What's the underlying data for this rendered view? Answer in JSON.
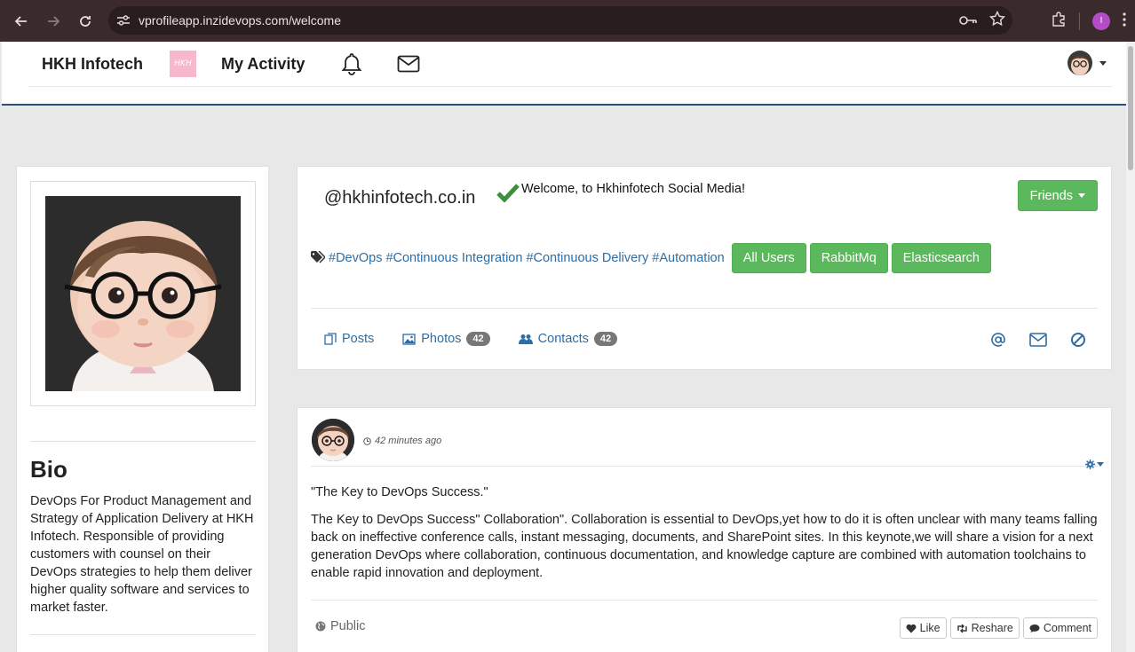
{
  "browser": {
    "url": "vprofileapp.inzidevops.com/welcome",
    "profile_initial": "I"
  },
  "navbar": {
    "brand": "HKH Infotech",
    "logo_text": "HKH",
    "my_activity": "My Activity"
  },
  "left_panel": {
    "bio_title": "Bio",
    "bio_text": "DevOps For Product Management and Strategy of Application Delivery at HKH Infotech. Responsible of providing customers with counsel on their DevOps strategies to help them deliver higher quality software and services to market faster."
  },
  "profile": {
    "handle": "@hkhinfotech.co.in",
    "welcome": "Welcome, to Hkhinfotech Social Media!",
    "friends_label": "Friends",
    "tags": [
      "#DevOps",
      "#Continuous Integration",
      "#Continuous Delivery",
      "#Automation"
    ],
    "buttons": [
      "All Users",
      "RabbitMq",
      "Elasticsearch"
    ],
    "tabs": {
      "posts": "Posts",
      "photos": "Photos",
      "photos_count": "42",
      "contacts": "Contacts",
      "contacts_count": "42"
    }
  },
  "post": {
    "time": "42 minutes ago",
    "title": "\"The Key to DevOps Success.\"",
    "body": "The Key to DevOps Success\" Collaboration\". Collaboration is essential to DevOps,yet how to do it is often unclear with many teams falling back on ineffective conference calls, instant messaging, documents, and SharePoint sites. In this keynote,we will share a vision for a next generation DevOps where collaboration, continuous documentation, and knowledge capture are combined with automation toolchains to enable rapid innovation and deployment.",
    "visibility": "Public",
    "like": "Like",
    "reshare": "Reshare",
    "comment": "Comment"
  },
  "colors": {
    "link": "#2e6da4",
    "success": "#5cb85c",
    "navbar_border": "#2b4f7a",
    "check": "#3e8e3e"
  }
}
